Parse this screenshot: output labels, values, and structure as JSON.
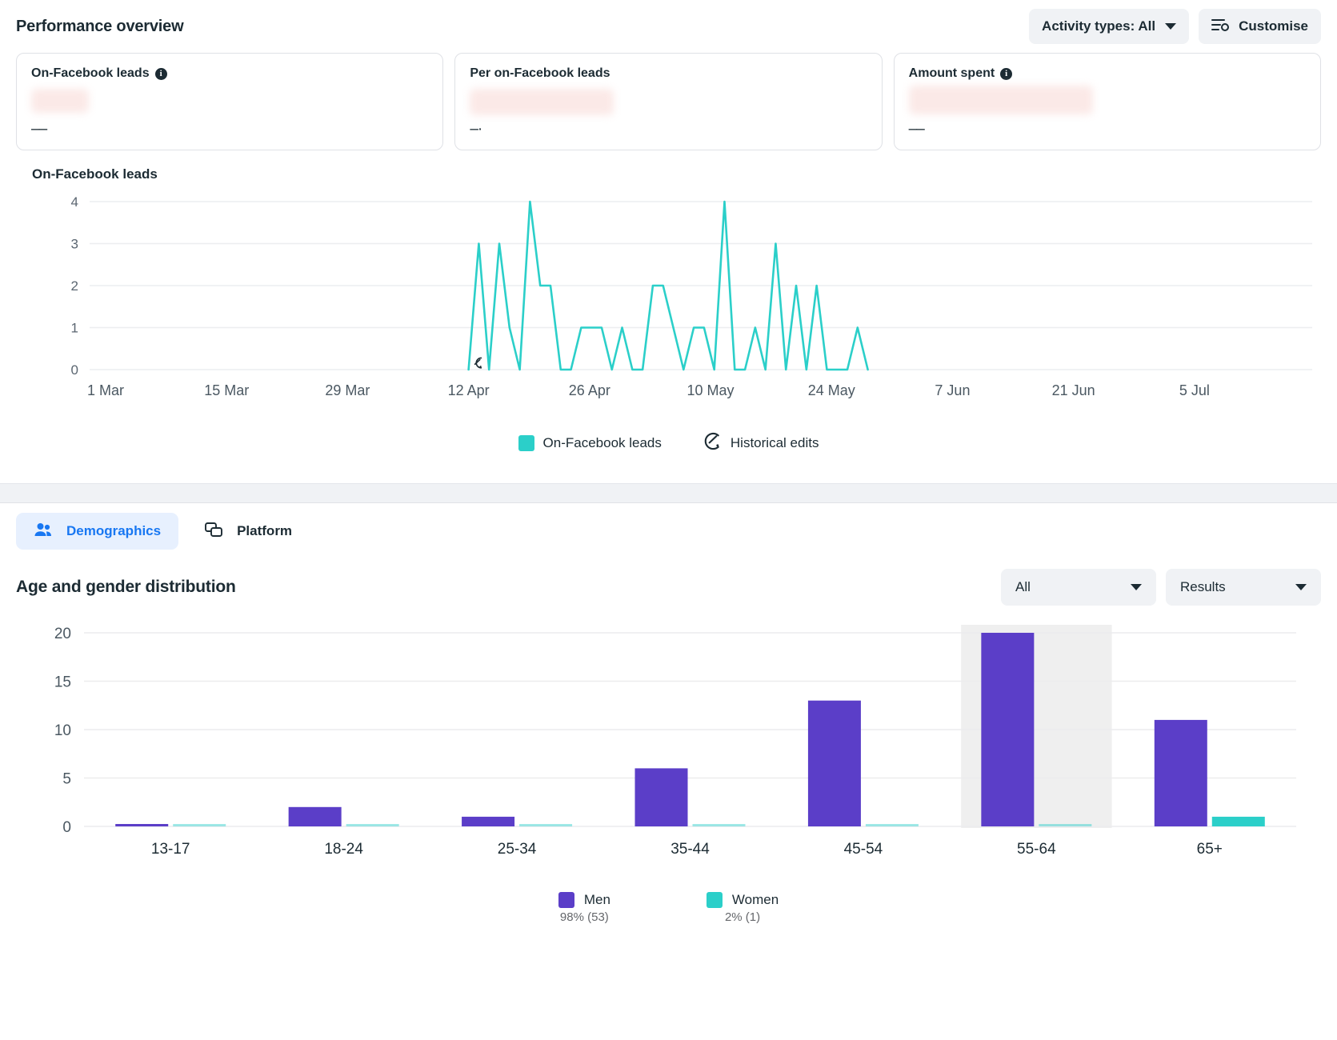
{
  "header": {
    "title": "Performance overview",
    "activity_types_label": "Activity types: All",
    "customise_label": "Customise"
  },
  "cards": [
    {
      "title": "On-Facebook leads",
      "has_info": true,
      "value": "––"
    },
    {
      "title": "Per on-Facebook leads",
      "has_info": false,
      "value": "–·"
    },
    {
      "title": "Amount spent",
      "has_info": true,
      "value": "––"
    }
  ],
  "line_section": {
    "title": "On-Facebook leads",
    "legend": [
      {
        "label": "On-Facebook leads",
        "icon": "color-swatch",
        "color": "#2bcfc9"
      },
      {
        "label": "Historical edits",
        "icon": "historical-edits-icon"
      }
    ]
  },
  "tabs": [
    {
      "label": "Demographics",
      "icon": "people-icon",
      "active": true
    },
    {
      "label": "Platform",
      "icon": "devices-icon",
      "active": false
    }
  ],
  "demographics": {
    "title": "Age and gender distribution",
    "breakdown_select": "All",
    "metric_select": "Results",
    "legend": [
      {
        "label": "Men",
        "sub": "98% (53)",
        "color": "#5b3ec8"
      },
      {
        "label": "Women",
        "sub": "2% (1)",
        "color": "#2bcfc9"
      }
    ]
  },
  "chart_data": [
    {
      "type": "line",
      "title": "On-Facebook leads",
      "xlabel": "",
      "ylabel": "",
      "ylim": [
        0,
        4
      ],
      "yticks": [
        0,
        1,
        2,
        3,
        4
      ],
      "grid": true,
      "legend_position": "bottom",
      "xticks": [
        "1 Mar",
        "15 Mar",
        "29 Mar",
        "12 Apr",
        "26 Apr",
        "10 May",
        "24 May",
        "7 Jun",
        "21 Jun",
        "5 Jul"
      ],
      "series": [
        {
          "name": "On-Facebook leads",
          "color": "#2bcfc9",
          "x_start_label": "12 Apr",
          "x_end_label": "28 May",
          "values": [
            0,
            3,
            0,
            3,
            1,
            0,
            4,
            2,
            2,
            0,
            0,
            1,
            1,
            1,
            0,
            1,
            0,
            0,
            2,
            2,
            1,
            0,
            1,
            1,
            0,
            4,
            0,
            0,
            1,
            0,
            3,
            0,
            2,
            0,
            2,
            0,
            0,
            0,
            1,
            0
          ]
        }
      ],
      "annotations": [
        {
          "type": "historical-edits-marker",
          "x_label": "12 Apr",
          "y": 0
        }
      ]
    },
    {
      "type": "bar",
      "title": "Age and gender distribution",
      "xlabel": "",
      "ylabel": "",
      "ylim": [
        0,
        20
      ],
      "yticks": [
        0,
        5,
        10,
        15,
        20
      ],
      "grid": true,
      "legend_position": "bottom",
      "categories": [
        "13-17",
        "18-24",
        "25-34",
        "35-44",
        "45-54",
        "55-64",
        "65+"
      ],
      "highlighted_category": "55-64",
      "series": [
        {
          "name": "Men",
          "color": "#5b3ec8",
          "values": [
            0.15,
            2,
            1,
            6,
            13,
            20,
            11
          ],
          "total": 53,
          "percent": "98%"
        },
        {
          "name": "Women",
          "color": "#2bcfc9",
          "values": [
            0.1,
            0.1,
            0.1,
            0.1,
            0.1,
            0.1,
            1
          ],
          "total": 1,
          "percent": "2%"
        }
      ]
    }
  ]
}
